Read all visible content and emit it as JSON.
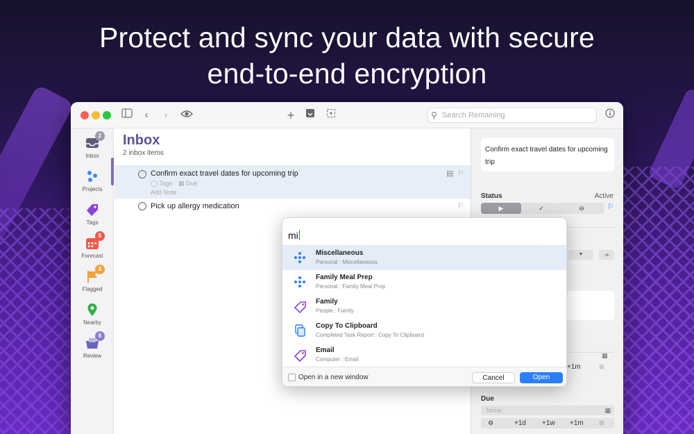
{
  "headline": {
    "line1": "Protect and sync your data with secure",
    "line2": "end-to-end encryption"
  },
  "toolbar": {
    "search_placeholder": "Search Remaining"
  },
  "sidebar": {
    "items": [
      {
        "label": "Inbox",
        "badge": "2",
        "icon": "inbox-icon"
      },
      {
        "label": "Projects",
        "badge": "",
        "icon": "projects-icon"
      },
      {
        "label": "Tags",
        "badge": "",
        "icon": "tag-icon"
      },
      {
        "label": "Forecast",
        "badge": "5",
        "icon": "calendar-icon"
      },
      {
        "label": "Flagged",
        "badge": "3",
        "icon": "flag-icon"
      },
      {
        "label": "Nearby",
        "badge": "",
        "icon": "location-icon"
      },
      {
        "label": "Review",
        "badge": "6",
        "icon": "review-icon"
      }
    ]
  },
  "main": {
    "title": "Inbox",
    "subtitle": "2 inbox items",
    "tasks": [
      {
        "title": "Confirm exact travel dates for upcoming trip",
        "tags": "Tags",
        "due": "Due",
        "note": "Add Note"
      },
      {
        "title": "Pick up allergy medication"
      }
    ]
  },
  "inspector": {
    "task_title": "Confirm exact travel dates for upcoming trip",
    "status_label": "Status",
    "status_value": "Active",
    "inc_1m": "+1m",
    "due_label": "Due",
    "due_value": "None",
    "due_buttons": [
      "+1d",
      "+1w",
      "+1m"
    ]
  },
  "popup": {
    "query": "mi",
    "options": [
      {
        "title": "Miscellaneous",
        "subtitle": "Personal : Miscellaneous",
        "icon": "project-icon"
      },
      {
        "title": "Family Meal Prep",
        "subtitle": "Personal : Family Meal Prep",
        "icon": "project-icon"
      },
      {
        "title": "Family",
        "subtitle": "People : Family",
        "icon": "tag-icon"
      },
      {
        "title": "Copy To Clipboard",
        "subtitle": "Completed Task Report : Copy To Clipboard",
        "icon": "copy-icon"
      },
      {
        "title": "Email",
        "subtitle": "Computer : Email",
        "icon": "tag-icon"
      }
    ],
    "new_window_label": "Open in a new window",
    "cancel_label": "Cancel",
    "open_label": "Open"
  },
  "colors": {
    "accent": "#2d7ff9",
    "inbox_title": "#5b5490",
    "badge_gray": "#9a9aa8",
    "badge_red": "#ef5a4c",
    "badge_orange": "#f2a23a",
    "badge_purple": "#8a7fd0"
  }
}
